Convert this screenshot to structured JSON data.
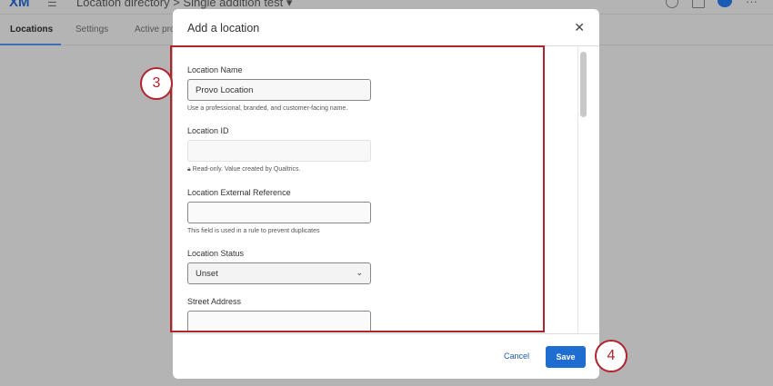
{
  "app": {
    "logo": "XM",
    "breadcrumb": "Location directory  >  Single addition test  ▾"
  },
  "tabs": [
    {
      "label": "Locations"
    },
    {
      "label": "Settings"
    },
    {
      "label": "Active pro"
    }
  ],
  "modal": {
    "title": "Add a location",
    "close": "✕",
    "fields": {
      "name": {
        "label": "Location Name",
        "value": "Provo Location",
        "help": "Use a professional, branded, and customer-facing name."
      },
      "id": {
        "label": "Location ID",
        "value": "",
        "help": "Read-only. Value created by Qualtrics."
      },
      "ext": {
        "label": "Location External Reference",
        "value": "",
        "help": "This field is used in a rule to prevent duplicates"
      },
      "status": {
        "label": "Location Status",
        "value": "Unset"
      },
      "street": {
        "label": "Street Address",
        "value": ""
      }
    },
    "cancel": "Cancel",
    "save": "Save"
  },
  "callouts": {
    "a": "3",
    "b": "4"
  },
  "colors": {
    "accent": "#1f6dd0",
    "callout": "#b0242e"
  }
}
